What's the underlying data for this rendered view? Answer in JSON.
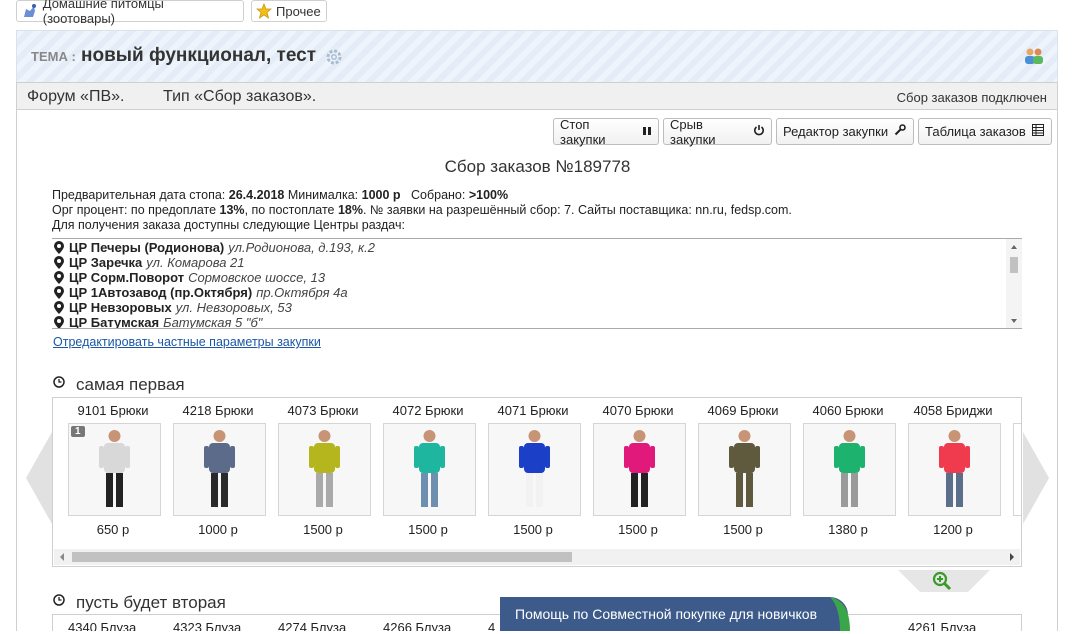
{
  "top_chips": [
    {
      "label": "Домашние питомцы (зоотовары)",
      "icon": "pet-icon"
    },
    {
      "label": "Прочее",
      "icon": "star-icon"
    }
  ],
  "topic": {
    "label": "ТЕМА :",
    "title": "новый функционал, тест"
  },
  "forum_bar": {
    "forum": "Форум «ПВ».",
    "type": "Тип «Сбор заказов».",
    "status": "Сбор заказов подключен"
  },
  "toolbar": {
    "stop": "Стоп закупки",
    "break": "Срыв закупки",
    "editor": "Редактор закупки",
    "table": "Таблица заказов"
  },
  "order": {
    "title": "Сбор заказов №189778",
    "line1": {
      "a": "Предварительная дата стопа:",
      "date": "26.4.2018",
      "b": "Минималка:",
      "min": "1000 р",
      "c": "Собрано:",
      "collected": ">100%"
    },
    "line2": {
      "a": "Орг процент: по предоплате",
      "pre": "13%",
      "b": ", по постоплате",
      "post": "18%",
      "c": ". № заявки на разрешённый сбор: 7. Сайты поставщика: nn.ru, fedsp.com."
    },
    "line3": "Для получения заказа доступны следующие Центры раздач:"
  },
  "pickup_points": [
    {
      "name": "ЦР Печеры (Родионова)",
      "address": "ул.Родионова, д.193, к.2"
    },
    {
      "name": "ЦР Заречка",
      "address": "ул. Комарова 21"
    },
    {
      "name": "ЦР Сорм.Поворот",
      "address": "Сормовское шоссе, 13"
    },
    {
      "name": "ЦР 1Автозавод (пр.Октября)",
      "address": "пр.Октября 4а"
    },
    {
      "name": "ЦР Невзоровых",
      "address": "ул. Невзоровых, 53"
    },
    {
      "name": "ЦР Батумская",
      "address": "Батумская 5 \"б\""
    }
  ],
  "edit_link": "Отредактировать частные параметры закупки",
  "section1": {
    "title": "самая первая",
    "items": [
      {
        "name": "9101 Брюки",
        "price": "650 р",
        "badge": "1",
        "top": "#d8d8d8",
        "bottom": "#222"
      },
      {
        "name": "4218 Брюки",
        "price": "1000 р",
        "badge": "",
        "top": "#5d6b8a",
        "bottom": "#2a2a2a"
      },
      {
        "name": "4073 Брюки",
        "price": "1500 р",
        "badge": "",
        "top": "#b5b51e",
        "bottom": "#aaaaaa"
      },
      {
        "name": "4072 Брюки",
        "price": "1500 р",
        "badge": "",
        "top": "#1fb6a0",
        "bottom": "#6f8fb0"
      },
      {
        "name": "4071 Брюки",
        "price": "1500 р",
        "badge": "",
        "top": "#1c3fc8",
        "bottom": "#f2f2f2"
      },
      {
        "name": "4070 Брюки",
        "price": "1500 р",
        "badge": "",
        "top": "#e0197a",
        "bottom": "#222"
      },
      {
        "name": "4069 Брюки",
        "price": "1500 р",
        "badge": "",
        "top": "#5f5a3e",
        "bottom": "#5f5a3e"
      },
      {
        "name": "4060 Брюки",
        "price": "1380 р",
        "badge": "",
        "top": "#1db36e",
        "bottom": "#9a9a9a"
      },
      {
        "name": "4058 Бриджи",
        "price": "1200 р",
        "badge": "",
        "top": "#f03b4e",
        "bottom": "#5b6f8a"
      },
      {
        "name": "4",
        "price": "",
        "badge": "",
        "top": "#ffffff",
        "bottom": "#ffffff"
      }
    ]
  },
  "section2": {
    "title": "пусть будет вторая",
    "items": [
      "4340 Блуза",
      "4323 Блуза",
      "4274 Блуза",
      "4266 Блуза",
      "4",
      "4261 Блуза"
    ]
  },
  "help_banner": "Помощь по Совместной покупке для новичков"
}
